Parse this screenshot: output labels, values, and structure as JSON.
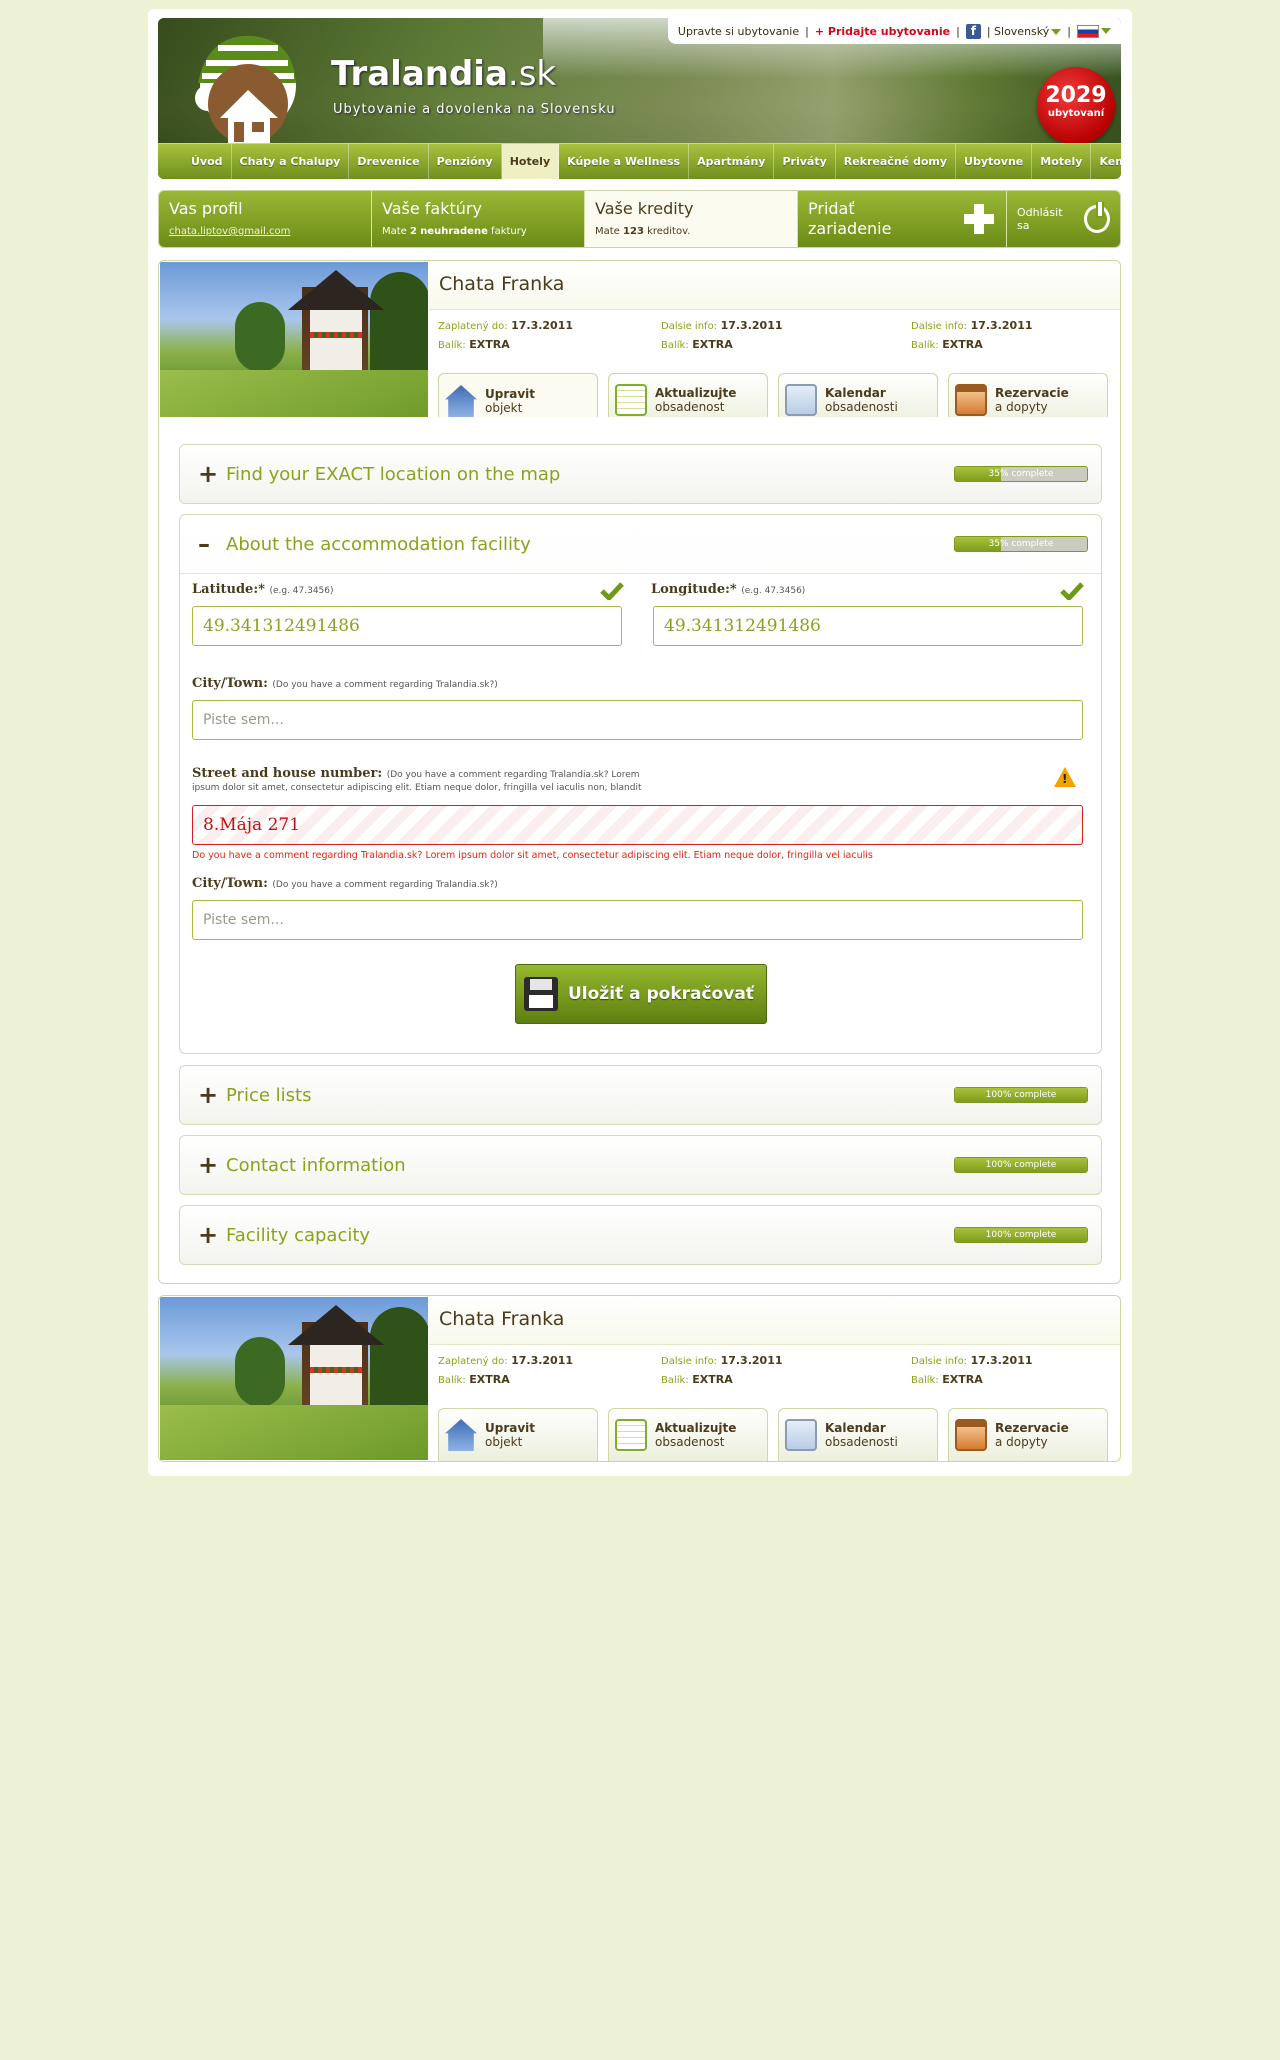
{
  "header": {
    "logo_main": "Tralandia",
    "logo_suffix": ".sk",
    "tagline": "Ubytovanie a dovolenka na Slovensku",
    "top_links": {
      "edit": "Upravte si ubytovanie",
      "add": "+ Pridajte ubytovanie",
      "language": "| Slovenský"
    },
    "badge_number": "2029",
    "badge_label": "ubytovaní"
  },
  "nav": [
    "Úvod",
    "Chaty a Chalupy",
    "Drevenice",
    "Penzióny",
    "Hotely",
    "Kúpele a Wellness",
    "Apartmány",
    "Priváty",
    "Rekreačné domy",
    "Ubytovne",
    "Motely",
    "Kempy"
  ],
  "userbar": {
    "profile_title": "Vas profil",
    "profile_email": "chata.liptov@gmail.com",
    "invoices_title": "Vaše faktúry",
    "invoices_sub_pre": "Mate",
    "invoices_count": "2",
    "invoices_sub_mid": "neuhradene",
    "invoices_sub_post": "faktury",
    "credits_title": "Vaše kredity",
    "credits_sub_pre": "Mate",
    "credits_count": "123",
    "credits_sub_post": "kreditov.",
    "add_title_1": "Pridať",
    "add_title_2": "zariadenie",
    "logout": "Odhlásit sa"
  },
  "property": {
    "name": "Chata Franka",
    "meta": [
      {
        "k1": "Zaplatený do:",
        "v1": "17.3.2011",
        "k2": "Balík:",
        "v2": "EXTRA"
      },
      {
        "k1": "Dalsie info:",
        "v1": "17.3.2011",
        "k2": "Balík:",
        "v2": "EXTRA"
      },
      {
        "k1": "Dalsie info:",
        "v1": "17.3.2011",
        "k2": "Balík:",
        "v2": "EXTRA"
      }
    ],
    "tabs": [
      {
        "l1": "Upravit",
        "l2": "objekt"
      },
      {
        "l1": "Aktualizujte",
        "l2": "obsadenost"
      },
      {
        "l1": "Kalendar",
        "l2": "obsadenosti"
      },
      {
        "l1": "Rezervacie",
        "l2": "a dopyty"
      }
    ]
  },
  "sections": {
    "map": {
      "title": "Find your EXACT location on the map",
      "progress": 0.35,
      "progress_label": "35% complete"
    },
    "about": {
      "title": "About the accommodation facility",
      "progress": 0.35,
      "progress_label": "35% complete"
    },
    "prices": {
      "title": "Price lists",
      "progress": 1.0,
      "progress_label": "100% complete"
    },
    "contact": {
      "title": "Contact information",
      "progress": 1.0,
      "progress_label": "100% complete"
    },
    "capacity": {
      "title": "Facility capacity",
      "progress": 1.0,
      "progress_label": "100% complete"
    }
  },
  "form": {
    "latitude_label": "Latitude:*",
    "latitude_hint": "(e.g. 47.3456)",
    "latitude_value": "49.341312491486",
    "longitude_label": "Longitude:*",
    "longitude_hint": "(e.g. 47.3456)",
    "longitude_value": "49.341312491486",
    "city_label": "City/Town:",
    "city_hint": "(Do you have a comment regarding Tralandia.sk?)",
    "city_placeholder": "Piste sem...",
    "street_label": "Street and house number:",
    "street_hint_1": "(Do you have a comment regarding Tralandia.sk? Lorem",
    "street_hint_2": "ipsum dolor sit amet, consectetur adipiscing elit. Etiam neque dolor, fringilla vel iaculis non, blandit",
    "street_value": "8.Mája 271",
    "street_error": "Do you have a comment regarding Tralandia.sk? Lorem ipsum dolor sit amet, consectetur adipiscing elit. Etiam neque dolor, fringilla vel iaculis",
    "city2_label": "City/Town:",
    "city2_hint": "(Do you have a comment regarding Tralandia.sk?)",
    "city2_placeholder": "Piste sem...",
    "save_label": "Uložiť a pokračovať"
  },
  "colors": {
    "accent": "#8aa31c",
    "error": "#d42020",
    "brand_dark": "#4a3b1c"
  }
}
